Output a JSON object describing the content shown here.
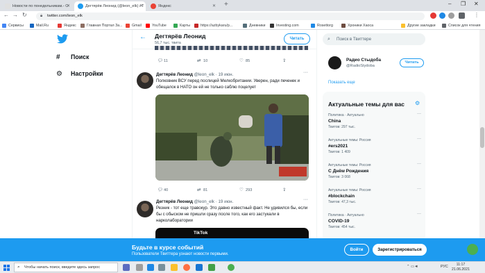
{
  "browser": {
    "tabs": [
      {
        "title": "Новости по понедельникам.- О",
        "fav_color": "#e0e0e0",
        "active": false
      },
      {
        "title": "Дегтярёв Леонид (@leon_elk) / Т",
        "fav_color": "#1d9bf0",
        "active": true
      },
      {
        "title": "Яндекс",
        "fav_color": "#ea4335",
        "active": false
      }
    ],
    "url": "twitter.com/leon_elk",
    "bookmarks": [
      {
        "label": "Сервисы",
        "color": "#4285f4"
      },
      {
        "label": "Mail.Ru",
        "color": "#1565c0"
      },
      {
        "label": "Яндекс",
        "color": "#e53935"
      },
      {
        "label": "Главная Портал За...",
        "color": "#8d6e63"
      },
      {
        "label": "Gmail",
        "color": "#ea4335"
      },
      {
        "label": "YouTube",
        "color": "#ff0000"
      },
      {
        "label": "Карты",
        "color": "#34a853"
      },
      {
        "label": "https://azbykaru/p...",
        "color": "#c62828"
      },
      {
        "label": "Дневники",
        "color": "#546e7a"
      },
      {
        "label": "Investing.com",
        "color": "#333333"
      },
      {
        "label": "Rosettorg",
        "color": "#1e88e5"
      },
      {
        "label": "Хроники Хаоса",
        "color": "#6d4c41"
      },
      {
        "label": "Другие закладки",
        "color": "#fbc02d"
      },
      {
        "label": "Список для чтения",
        "color": "#5f6368"
      }
    ]
  },
  "twitter": {
    "nav": {
      "search_label": "Поиск",
      "settings_label": "Настройки"
    },
    "header": {
      "name": "Дегтярёв Леонид",
      "tweet_count": "56,7 тыс. твита",
      "follow_label": "Читать"
    },
    "top_actions": {
      "replies": "11",
      "retweets": "10",
      "likes": "85"
    },
    "tweets": [
      {
        "name": "Дегтярёв Леонид",
        "handle_date": "@leon_elk · 19 июн.",
        "text": "Полковник ВСУ перед послицей Мелкобритании. Уверен, ради печенек и обещалок в НАТО он ей не только саблю поцелует",
        "replies": "40",
        "retweets": "81",
        "likes": "293"
      },
      {
        "name": "Дегтярёв Леонид",
        "handle_date": "@leon_elk · 19 июн.",
        "text": "Резник - тот еще травокур. Это давно известный факт. Не удивился бы, если бы с обыском не пришли сразу после того, как его застукали в нарколаборатории",
        "video_label": "TikTok"
      }
    ],
    "sidebar": {
      "search_placeholder": "Поиск в Твиттере",
      "who_to_follow": {
        "name": "Радио Стыдоба",
        "handle": "@RadioStydoba",
        "follow_label": "Читать"
      },
      "show_more": "Показать еще",
      "trends_title": "Актуальные темы для вас",
      "trends": [
        {
          "context": "Политика · Актуально",
          "title": "China",
          "count": "Твитов: 297 тыс."
        },
        {
          "context": "Актуальные темы: Россия",
          "title": "#ers2021",
          "count": "Твитов: 1 409"
        },
        {
          "context": "Актуальные темы: Россия",
          "title": "С Днём Рождения",
          "count": "Твитов: 3 068"
        },
        {
          "context": "Актуальные темы: Россия",
          "title": "#blockchain",
          "count": "Твитов: 47,3 тыс."
        },
        {
          "context": "Политика · Актуально",
          "title": "COVID-19",
          "count": "Твитов: 454 тыс."
        }
      ]
    },
    "banner": {
      "headline": "Будьте в курсе событий",
      "subtext": "Пользователи Твиттера узнают новости первыми.",
      "login_label": "Войти",
      "signup_label": "Зарегистрироваться"
    }
  },
  "taskbar": {
    "search_placeholder": "Чтобы начать поиск, введите здесь запрос",
    "lang": "РУС",
    "time": "11:17",
    "date": "21.06.2021"
  }
}
